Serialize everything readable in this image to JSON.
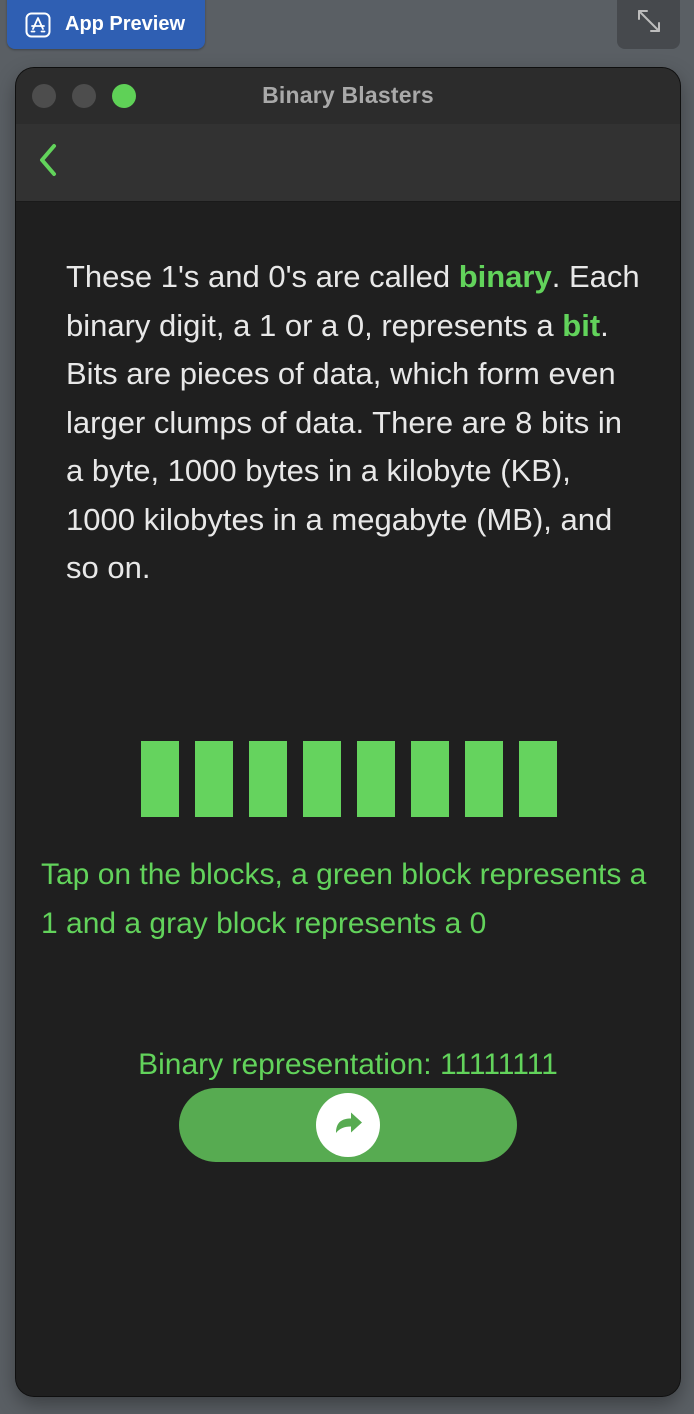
{
  "host": {
    "app_preview_label": "App Preview",
    "app_preview_icon": "app-store-icon",
    "expand_icon": "expand-arrows-icon"
  },
  "window": {
    "title": "Binary Blasters",
    "traffic_lights": [
      "close",
      "minimize",
      "zoom"
    ]
  },
  "navbar": {
    "back_icon": "chevron-left-icon"
  },
  "lesson": {
    "intro_parts": [
      "These 1's and 0's are called ",
      "binary",
      ". Each binary digit, a 1 or a 0, represents a ",
      "bit",
      ". Bits are pieces of data, which form even larger clumps of data. There are 8 bits in a byte, 1000 bytes in a kilobyte (KB), 1000 kilobytes in a megabyte (MB), and so on."
    ],
    "bits": [
      1,
      1,
      1,
      1,
      1,
      1,
      1,
      1
    ],
    "instruction": "Tap on the blocks, a green block represents a 1 and a gray block represents a 0",
    "binary_label": "Binary representation: 11111111",
    "next_icon": "forward-arrow-icon"
  },
  "colors": {
    "accent_green": "#62d35b",
    "block_on": "#65d35e",
    "block_off": "#8a8a8a",
    "button_green": "#57ab51",
    "window_bg": "#1f1f1f",
    "host_button_blue": "#2f5fb3"
  }
}
